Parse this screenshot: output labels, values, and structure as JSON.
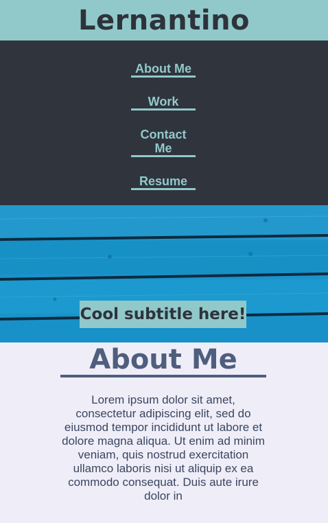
{
  "header": {
    "site_title": "Lernantino"
  },
  "nav": {
    "items": [
      {
        "label": "About Me"
      },
      {
        "label": "Work"
      },
      {
        "label": "Contact Me"
      },
      {
        "label": "Resume"
      }
    ]
  },
  "hero": {
    "subtitle": "Cool subtitle here!"
  },
  "about": {
    "heading": "About Me",
    "body": "Lorem ipsum dolor sit amet, consectetur adipiscing elit, sed do eiusmod tempor incididunt ut labore et dolore magna aliqua. Ut enim ad minim veniam, quis nostrud exercitation ullamco laboris nisi ut aliquip ex ea commodo consequat. Duis aute irure dolor in"
  },
  "colors": {
    "header_bg": "#91c9cb",
    "nav_bg": "#30343d",
    "accent": "#91c9cb",
    "heading": "#4f5e7e",
    "page_bg": "#efeef8"
  }
}
